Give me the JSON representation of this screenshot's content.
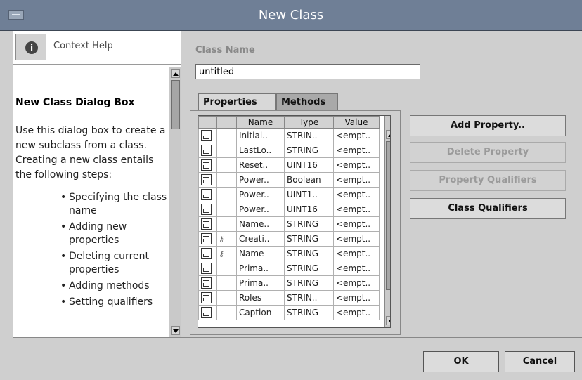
{
  "window": {
    "title": "New Class"
  },
  "help": {
    "header_label": "Context Help",
    "icon": "info-icon",
    "title": "New Class Dialog Box",
    "body": "Use this dialog box to create a new subclass from a class. Creating a new class entails the following steps:",
    "steps": [
      "Specifying the class name",
      "Adding new properties",
      "Deleting current properties",
      "Adding methods",
      "Setting qualifiers"
    ]
  },
  "form": {
    "class_name_label": "Class Name",
    "class_name_value": "untitled"
  },
  "tabs": [
    {
      "label": "Properties",
      "active": true
    },
    {
      "label": "Methods",
      "active": false
    }
  ],
  "table": {
    "columns": [
      "Name",
      "Type",
      "Value"
    ],
    "rows": [
      {
        "name": "Initial..",
        "type": "STRIN..",
        "value": "<empt..",
        "key": false
      },
      {
        "name": "LastLo..",
        "type": "STRING",
        "value": "<empt..",
        "key": false
      },
      {
        "name": "Reset..",
        "type": "UINT16",
        "value": "<empt..",
        "key": false
      },
      {
        "name": "Power..",
        "type": "Boolean",
        "value": "<empt..",
        "key": false
      },
      {
        "name": "Power..",
        "type": "UINT1..",
        "value": "<empt..",
        "key": false
      },
      {
        "name": "Power..",
        "type": "UINT16",
        "value": "<empt..",
        "key": false
      },
      {
        "name": "Name..",
        "type": "STRING",
        "value": "<empt..",
        "key": false
      },
      {
        "name": "Creati..",
        "type": "STRING",
        "value": "<empt..",
        "key": true
      },
      {
        "name": "Name",
        "type": "STRING",
        "value": "<empt..",
        "key": true
      },
      {
        "name": "Prima..",
        "type": "STRING",
        "value": "<empt..",
        "key": false
      },
      {
        "name": "Prima..",
        "type": "STRING",
        "value": "<empt..",
        "key": false
      },
      {
        "name": "Roles",
        "type": "STRIN..",
        "value": "<empt..",
        "key": false
      },
      {
        "name": "Caption",
        "type": "STRING",
        "value": "<empt..",
        "key": false
      }
    ]
  },
  "buttons": {
    "add_property": "Add Property..",
    "delete_property": "Delete Property",
    "property_qualifiers": "Property Qualifiers",
    "class_qualifiers": "Class Qualifiers",
    "ok": "OK",
    "cancel": "Cancel"
  }
}
